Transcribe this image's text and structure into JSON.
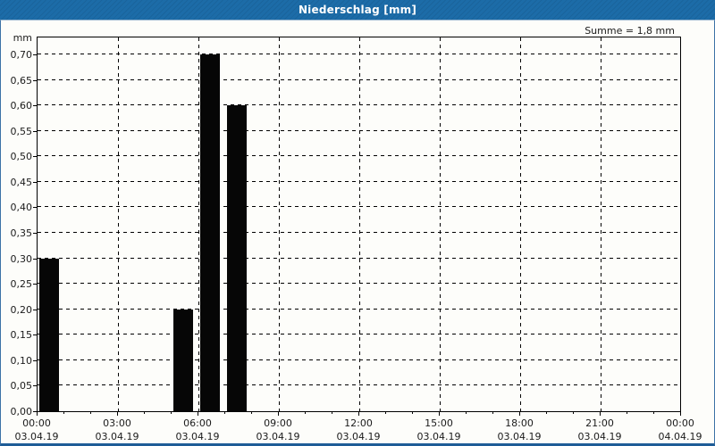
{
  "window": {
    "title": "Niederschlag [mm]"
  },
  "colors": {
    "titlebar_bg": "#1c6ca8",
    "titlebar_text": "#ffffff",
    "panel_border": "#3d72a6",
    "bottom_border": "#1e5c97",
    "bar": "#060606",
    "grid": "#000000",
    "text": "#1b1b1b"
  },
  "chart_data": {
    "type": "bar",
    "title": "Niederschlag [mm]",
    "unit": "mm",
    "summary": "Summe = 1,8 mm",
    "ylabel": "mm",
    "xlabel": "",
    "ylim": [
      0,
      0.7
    ],
    "y_tick_step": 0.05,
    "y_tick_labels": [
      "0,00",
      "0,05",
      "0,10",
      "0,15",
      "0,20",
      "0,25",
      "0,30",
      "0,35",
      "0,40",
      "0,45",
      "0,50",
      "0,55",
      "0,60",
      "0,65",
      "0,70"
    ],
    "grid": "dashed",
    "legend": "none",
    "x_axis": {
      "total_hours": 24,
      "major_step_hours": 3,
      "minor_step_hours": 1,
      "tick_labels": [
        {
          "time": "00:00",
          "date": "03.04.19"
        },
        {
          "time": "03:00",
          "date": "03.04.19"
        },
        {
          "time": "06:00",
          "date": "03.04.19"
        },
        {
          "time": "09:00",
          "date": "03.04.19"
        },
        {
          "time": "12:00",
          "date": "03.04.19"
        },
        {
          "time": "15:00",
          "date": "03.04.19"
        },
        {
          "time": "18:00",
          "date": "03.04.19"
        },
        {
          "time": "21:00",
          "date": "03.04.19"
        },
        {
          "time": "00:00",
          "date": "04.04.19"
        }
      ]
    },
    "bars": [
      {
        "start_hour": 0,
        "duration_hours": 1,
        "value": 0.3
      },
      {
        "start_hour": 5,
        "duration_hours": 1,
        "value": 0.2
      },
      {
        "start_hour": 6,
        "duration_hours": 1,
        "value": 0.7
      },
      {
        "start_hour": 7,
        "duration_hours": 1,
        "value": 0.6
      }
    ],
    "total_mm": 1.8
  }
}
